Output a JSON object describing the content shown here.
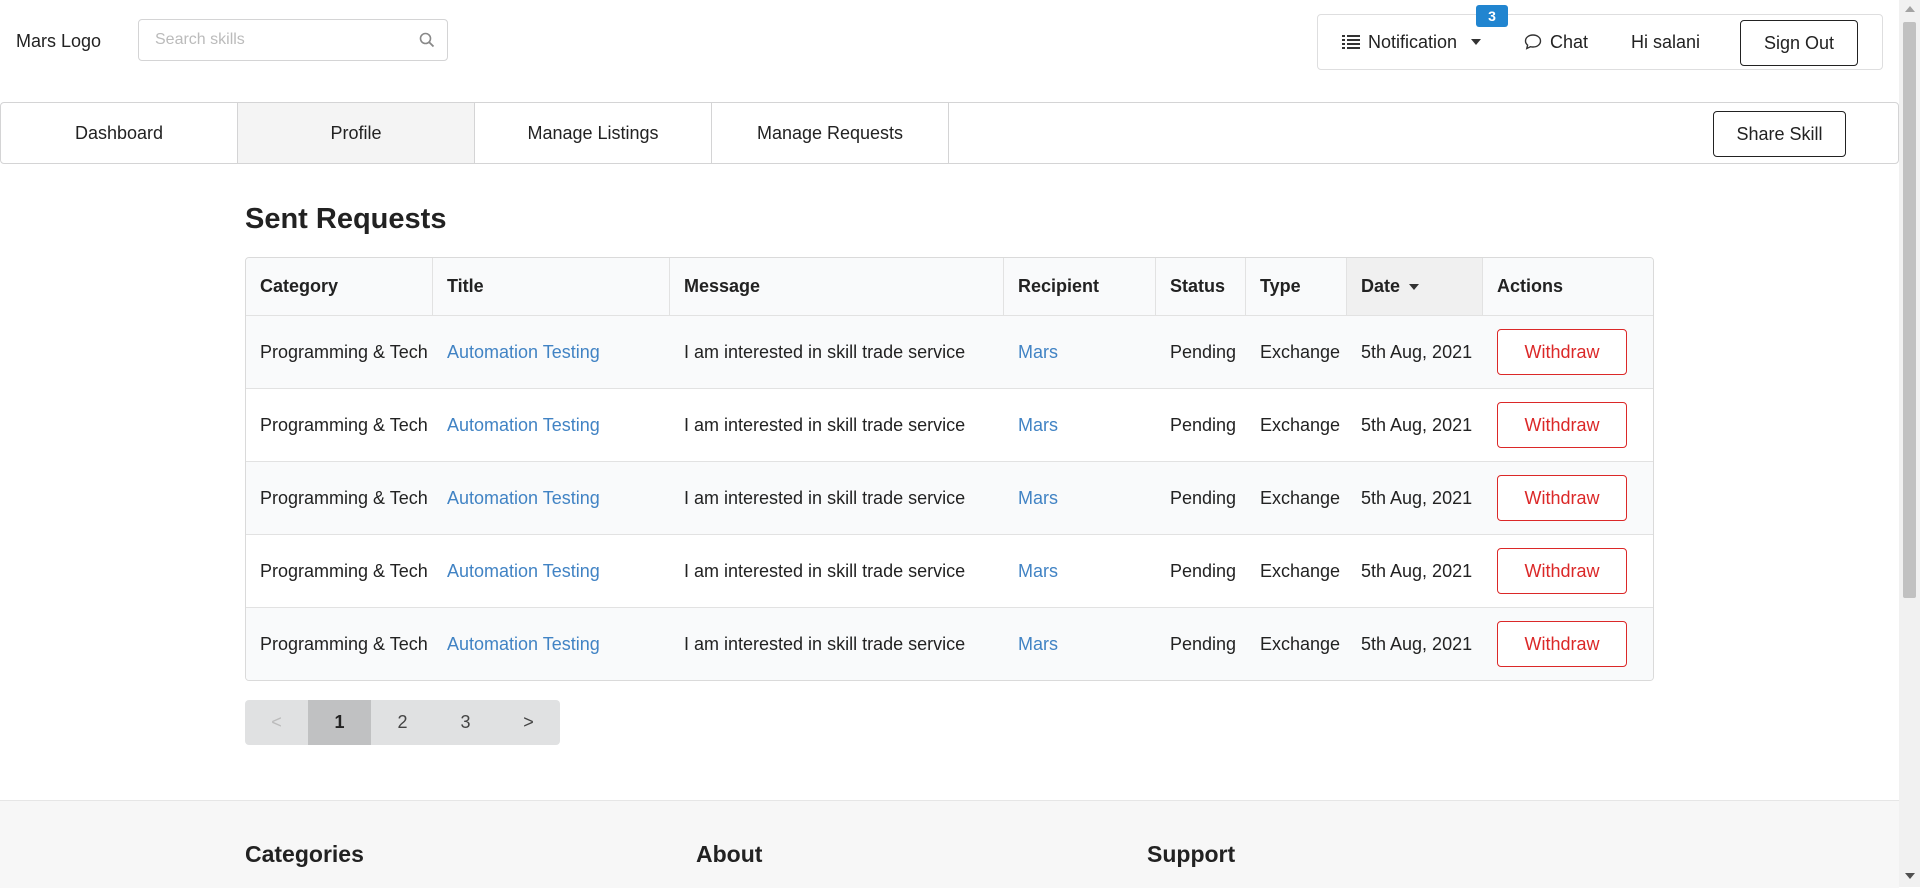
{
  "header": {
    "logo": "Mars Logo",
    "search_placeholder": "Search skills",
    "notification_label": "Notification",
    "notification_count": "3",
    "chat_label": "Chat",
    "greeting": "Hi salani",
    "sign_out": "Sign Out"
  },
  "nav": {
    "tabs": [
      {
        "label": "Dashboard"
      },
      {
        "label": "Profile",
        "active": true
      },
      {
        "label": "Manage Listings"
      },
      {
        "label": "Manage Requests"
      }
    ],
    "share_skill": "Share Skill"
  },
  "page_title": "Sent Requests",
  "table": {
    "columns": [
      "Category",
      "Title",
      "Message",
      "Recipient",
      "Status",
      "Type",
      "Date",
      "Actions"
    ],
    "sorted_column": "Date",
    "rows": [
      {
        "category": "Programming & Tech",
        "title": "Automation Testing",
        "message": "I am interested in skill trade service",
        "recipient": "Mars",
        "status": "Pending",
        "type": "Exchange",
        "date": "5th Aug, 2021",
        "action": "Withdraw"
      },
      {
        "category": "Programming & Tech",
        "title": "Automation Testing",
        "message": "I am interested in skill trade service",
        "recipient": "Mars",
        "status": "Pending",
        "type": "Exchange",
        "date": "5th Aug, 2021",
        "action": "Withdraw"
      },
      {
        "category": "Programming & Tech",
        "title": "Automation Testing",
        "message": "I am interested in skill trade service",
        "recipient": "Mars",
        "status": "Pending",
        "type": "Exchange",
        "date": "5th Aug, 2021",
        "action": "Withdraw"
      },
      {
        "category": "Programming & Tech",
        "title": "Automation Testing",
        "message": "I am interested in skill trade service",
        "recipient": "Mars",
        "status": "Pending",
        "type": "Exchange",
        "date": "5th Aug, 2021",
        "action": "Withdraw"
      },
      {
        "category": "Programming & Tech",
        "title": "Automation Testing",
        "message": "I am interested in skill trade service",
        "recipient": "Mars",
        "status": "Pending",
        "type": "Exchange",
        "date": "5th Aug, 2021",
        "action": "Withdraw"
      }
    ]
  },
  "pagination": {
    "prev": "<",
    "pages": [
      "1",
      "2",
      "3"
    ],
    "active_page": "1",
    "next": ">"
  },
  "footer": {
    "headings": [
      "Categories",
      "About",
      "Support"
    ]
  },
  "colors": {
    "link": "#4183c4",
    "withdraw": "#db2828",
    "badge": "#2185d0"
  }
}
